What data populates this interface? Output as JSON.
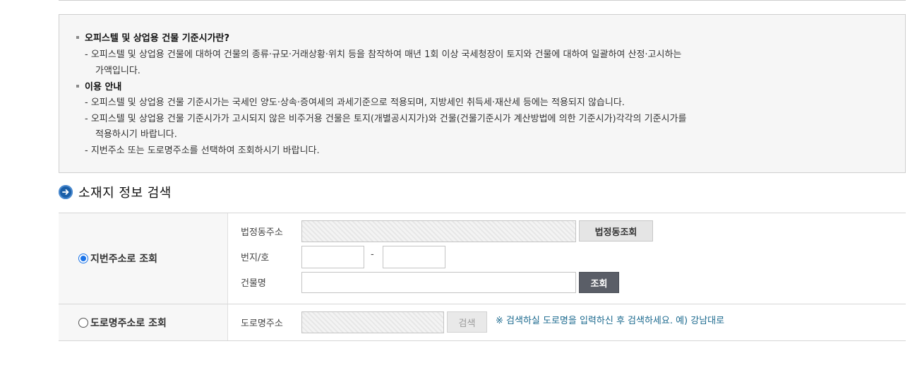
{
  "info": {
    "heading1": "오피스텔 및 상업용 건물 기준시가란?",
    "line1a": "- 오피스텔 및 상업용 건물에 대하여 건물의 종류·규모·거래상황·위치 등을 참작하여 매년 1회 이상 국세청장이 토지와 건물에 대하여 일괄하여 산정·고시하는",
    "line1b": "가액입니다.",
    "heading2": "이용 안내",
    "line2": "- 오피스텔 및 상업용 건물 기준시가는 국세인 양도·상속·증여세의 과세기준으로 적용되며, 지방세인 취득세·재산세 등에는 적용되지 않습니다.",
    "line3a": "- 오피스텔 및 상업용 건물 기준시가가 고시되지 않은 비주거용 건물은 토지(개별공시지가)와 건물(건물기준시가 계산방법에 의한 기준시가)각각의 기준시가를",
    "line3b": "적용하시기 바랍니다.",
    "line4": "- 지번주소 또는 도로명주소를 선택하여 조회하시기 바랍니다."
  },
  "section": {
    "title": "소재지 정보 검색"
  },
  "form": {
    "jibun_radio_label": "지번주소로 조회",
    "road_radio_label": "도로명주소로 조회",
    "jibun_selected": true,
    "legal_dong_label": "법정동주소",
    "legal_dong_value": "",
    "legal_dong_button": "법정동조회",
    "lot_label": "번지/호",
    "lot_main_value": "",
    "lot_dash": "-",
    "lot_sub_value": "",
    "building_label": "건물명",
    "building_value": "",
    "search_button": "조회",
    "road_label": "도로명주소",
    "road_value": "",
    "road_search_button": "검색",
    "road_note": "※ 검색하실 도로명을 입력하신 후 검색하세요. 예) 강남대로"
  },
  "colors": {
    "accent_blue": "#1a5fa8",
    "note_text": "#1c6a8f",
    "dark_button": "#5a5e67"
  }
}
